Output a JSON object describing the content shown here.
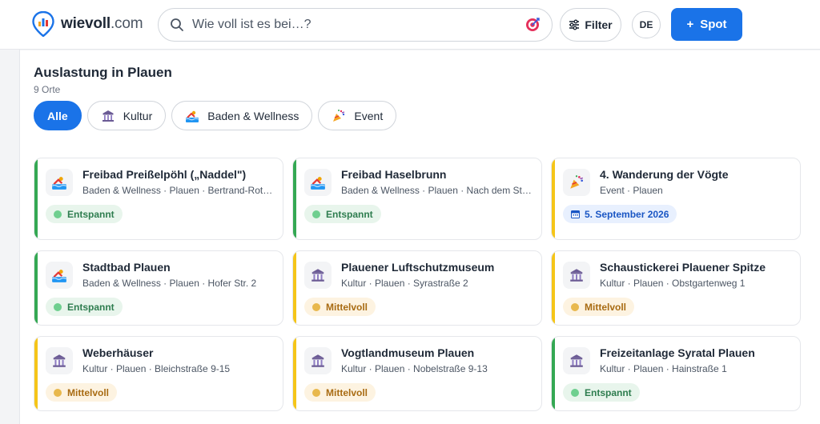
{
  "header": {
    "logo_name": "wievoll",
    "logo_tld": ".com",
    "search_placeholder": "Wie voll ist es bei…?",
    "filter_label": "Filter",
    "lang_label": "DE",
    "spot_label": "Spot",
    "spot_plus": "+"
  },
  "main": {
    "title": "Auslastung in Plauen",
    "count": "9 Orte"
  },
  "chips": [
    {
      "label": "Alle",
      "active": true
    },
    {
      "label": "Kultur",
      "icon": "museum-icon"
    },
    {
      "label": "Baden & Wellness",
      "icon": "swimming-pool-icon"
    },
    {
      "label": "Event",
      "icon": "party-popper-icon"
    }
  ],
  "cards": [
    {
      "name": "Freibad Preißelpöhl („Naddel\")",
      "meta": "Baden & Wellness · Plauen · Bertrand-Roth-Straße",
      "status": "Entspannt",
      "status_color": "#34a853",
      "icon": "swimming-pool-icon"
    },
    {
      "name": "Freibad Haselbrunn",
      "meta": "Baden & Wellness · Plauen · Nach dem Stadion",
      "status": "Entspannt",
      "status_color": "#34a853",
      "icon": "swimming-pool-icon"
    },
    {
      "name": "4. Wanderung der Vögte",
      "meta": "Event · Plauen",
      "status": "5. September 2026",
      "status_color": "#f5c518",
      "icon": "party-popper-icon"
    },
    {
      "name": "Stadtbad Plauen",
      "meta": "Baden & Wellness · Plauen · Hofer Str. 2",
      "status": "Entspannt",
      "status_color": "#34a853",
      "icon": "swimming-pool-icon"
    },
    {
      "name": "Plauener Luftschutzmuseum",
      "meta": "Kultur · Plauen · Syrastraße 2",
      "status": "Mittelvoll",
      "status_color": "#f5c518",
      "icon": "museum-icon"
    },
    {
      "name": "Schaustickerei Plauener Spitze",
      "meta": "Kultur · Plauen · Obstgartenweg 1",
      "status": "Mittelvoll",
      "status_color": "#f5c518",
      "icon": "museum-icon"
    },
    {
      "name": "Weberhäuser",
      "meta": "Kultur · Plauen · Bleichstraße 9-15",
      "status": "Mittelvoll",
      "status_color": "#f5c518",
      "icon": "museum-icon"
    },
    {
      "name": "Vogtlandmuseum Plauen",
      "meta": "Kultur · Plauen · Nobelstraße 9-13",
      "status": "Mittelvoll",
      "status_color": "#f5c518",
      "icon": "museum-icon"
    },
    {
      "name": "Freizeitanlage Syratal Plauen",
      "meta": "Kultur · Plauen · Hainstraße 1",
      "status": "Entspannt",
      "status_color": "#34a853",
      "icon": "museum-icon"
    }
  ],
  "colors": {
    "accent": "#1a73e8",
    "status_green": "#34a853",
    "status_yellow": "#f5c518"
  }
}
